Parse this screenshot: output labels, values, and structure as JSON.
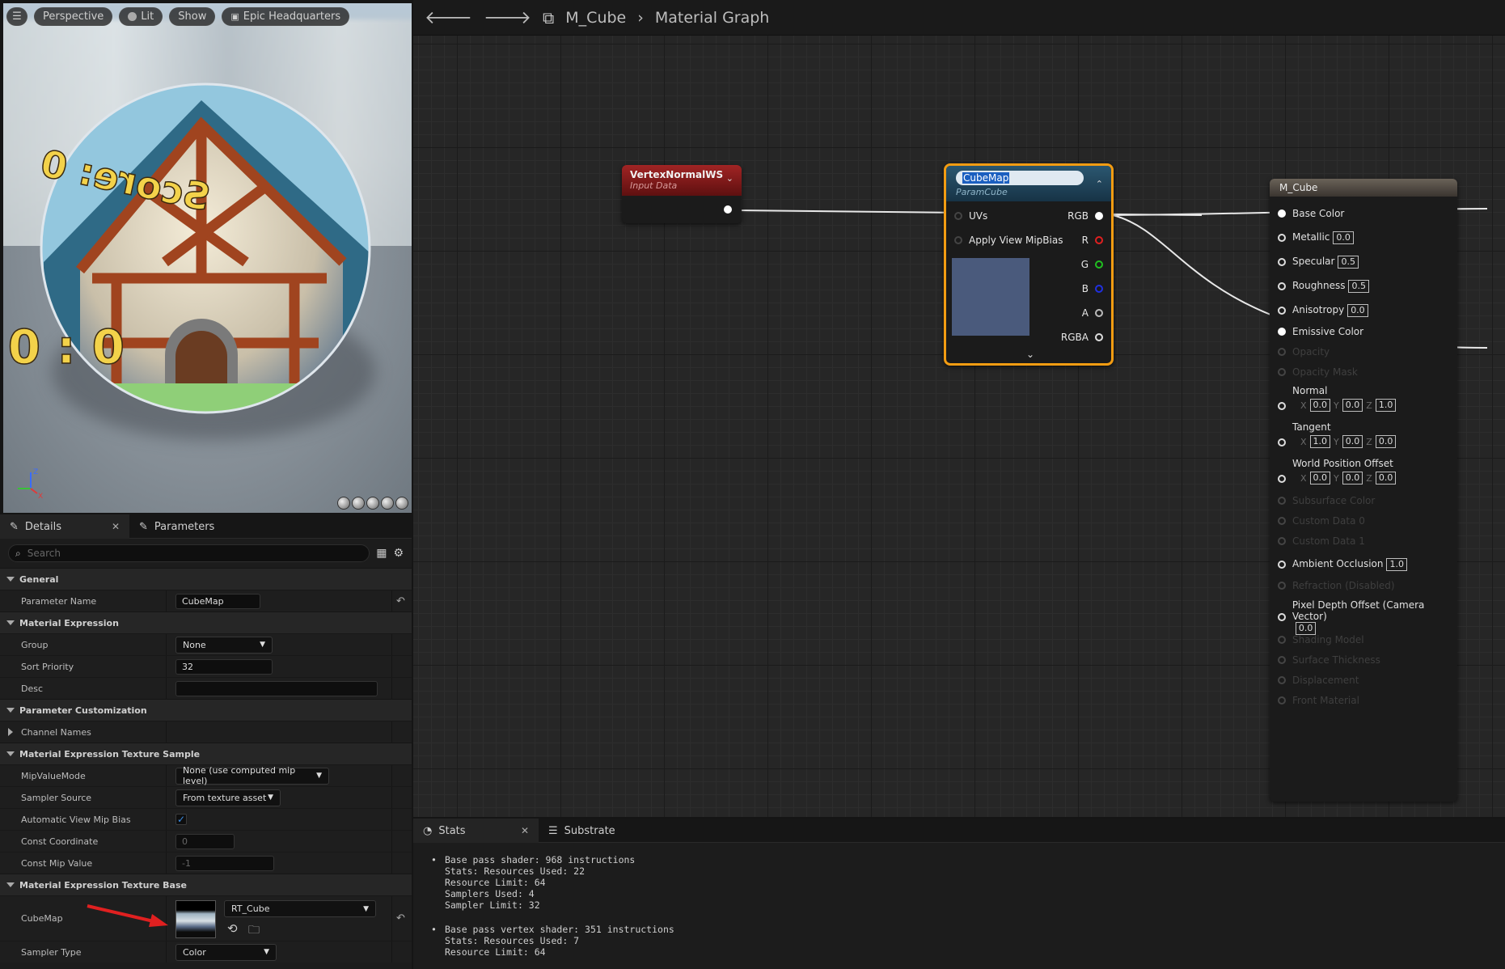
{
  "viewport": {
    "toolbar": {
      "perspective": "Perspective",
      "lit": "Lit",
      "show": "Show",
      "preview_scene": "Epic Headquarters"
    },
    "sphere_text": {
      "score": "Score: 0",
      "count": "0 : 0"
    }
  },
  "details": {
    "tabs": [
      {
        "label": "Details"
      },
      {
        "label": "Parameters"
      }
    ],
    "search_placeholder": "Search",
    "sections": {
      "general": "General",
      "material_expression": "Material Expression",
      "parameter_customization": "Parameter Customization",
      "texture_sample": "Material Expression Texture Sample",
      "texture_base": "Material Expression Texture Base"
    },
    "fields": {
      "parameter_name": {
        "label": "Parameter Name",
        "value": "CubeMap"
      },
      "group": {
        "label": "Group",
        "value": "None"
      },
      "sort_priority": {
        "label": "Sort Priority",
        "value": "32"
      },
      "desc": {
        "label": "Desc",
        "value": ""
      },
      "channel_names": {
        "label": "Channel Names"
      },
      "mip_value_mode": {
        "label": "MipValueMode",
        "value": "None (use computed mip level)"
      },
      "sampler_source": {
        "label": "Sampler Source",
        "value": "From texture asset"
      },
      "auto_view_mip_bias": {
        "label": "Automatic View Mip Bias",
        "checked": true
      },
      "const_coordinate": {
        "label": "Const Coordinate",
        "value": "0"
      },
      "const_mip_value": {
        "label": "Const Mip Value",
        "value": "-1"
      },
      "cubemap": {
        "label": "CubeMap",
        "value": "RT_Cube"
      },
      "sampler_type": {
        "label": "Sampler Type",
        "value": "Color"
      }
    }
  },
  "graph": {
    "breadcrumb": {
      "asset": "M_Cube",
      "graph": "Material Graph"
    },
    "vertex_node": {
      "title": "VertexNormalWS",
      "subtitle": "Input Data"
    },
    "param_node": {
      "name": "CubeMap",
      "subtitle": "ParamCube",
      "inputs": [
        "UVs",
        "Apply View MipBias"
      ],
      "outputs": [
        "RGB",
        "R",
        "G",
        "B",
        "A",
        "RGBA"
      ],
      "preview_color": "#4a5a7c"
    },
    "material_node": {
      "title": "M_Cube",
      "pins": [
        {
          "label": "Base Color",
          "connected": true
        },
        {
          "label": "Metallic",
          "value": "0.0"
        },
        {
          "label": "Specular",
          "value": "0.5"
        },
        {
          "label": "Roughness",
          "value": "0.5"
        },
        {
          "label": "Anisotropy",
          "value": "0.0"
        },
        {
          "label": "Emissive Color",
          "connected": true
        },
        {
          "label": "Opacity",
          "disabled": true
        },
        {
          "label": "Opacity Mask",
          "disabled": true
        },
        {
          "label": "Normal",
          "xyz": [
            "0.0",
            "0.0",
            "1.0"
          ]
        },
        {
          "label": "Tangent",
          "xyz": [
            "1.0",
            "0.0",
            "0.0"
          ]
        },
        {
          "label": "World Position Offset",
          "xyz": [
            "0.0",
            "0.0",
            "0.0"
          ]
        },
        {
          "label": "Subsurface Color",
          "disabled": true
        },
        {
          "label": "Custom Data 0",
          "disabled": true
        },
        {
          "label": "Custom Data 1",
          "disabled": true
        },
        {
          "label": "Ambient Occlusion",
          "value": "1.0"
        },
        {
          "label": "Refraction (Disabled)",
          "disabled": true
        },
        {
          "label": "Pixel Depth Offset (Camera Vector)",
          "value": "0.0"
        },
        {
          "label": "Shading Model",
          "disabled": true
        },
        {
          "label": "Surface Thickness",
          "disabled": true
        },
        {
          "label": "Displacement",
          "disabled": true
        },
        {
          "label": "Front Material",
          "disabled": true
        }
      ]
    },
    "axis": {
      "x": "X",
      "y": "Y",
      "z": "Z"
    }
  },
  "stats": {
    "tabs": [
      {
        "label": "Stats"
      },
      {
        "label": "Substrate"
      }
    ],
    "lines": [
      "Base pass shader: 968 instructions",
      "Stats: Resources Used: 22",
      "Resource Limit: 64",
      "Samplers Used: 4",
      "Sampler Limit: 32",
      "Base pass vertex shader: 351 instructions",
      "Stats: Resources Used: 7",
      "Resource Limit: 64"
    ]
  },
  "colors": {
    "accent": "#f39c12",
    "vertex_header": "#8b1e1e",
    "param_header": "#1f3f52",
    "link": "#e0e0e0"
  }
}
